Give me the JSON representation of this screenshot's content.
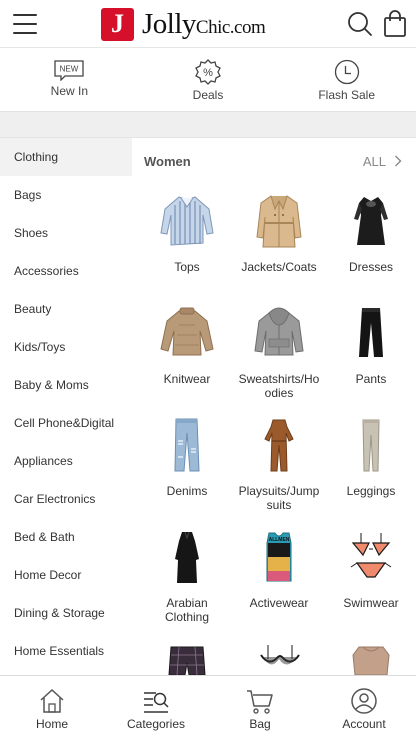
{
  "header": {
    "logo_mark": "J",
    "logo_big": "Jolly",
    "logo_rest": "Chic",
    "logo_suffix": ".com",
    "menu_icon": "hamburger-icon",
    "search_icon": "search-icon",
    "bag_icon": "shopping-bag-icon"
  },
  "quick_links": [
    {
      "label": "New In",
      "icon": "new-badge-icon",
      "badge": "NEW"
    },
    {
      "label": "Deals",
      "icon": "percent-badge-icon"
    },
    {
      "label": "Flash Sale",
      "icon": "clock-icon"
    }
  ],
  "sidebar": {
    "items": [
      {
        "label": "Clothing"
      },
      {
        "label": "Bags"
      },
      {
        "label": "Shoes"
      },
      {
        "label": "Accessories"
      },
      {
        "label": "Beauty"
      },
      {
        "label": "Kids/Toys"
      },
      {
        "label": "Baby & Moms"
      },
      {
        "label": "Cell Phone&Digital"
      },
      {
        "label": "Appliances"
      },
      {
        "label": "Car Electronics"
      },
      {
        "label": "Bed & Bath"
      },
      {
        "label": "Home Decor"
      },
      {
        "label": "Dining & Storage"
      },
      {
        "label": "Home Essentials"
      }
    ],
    "active_index": 0
  },
  "main": {
    "section_title": "Women",
    "all_label": "ALL",
    "categories": [
      {
        "label": "Tops",
        "icon": "striped-shirt-image"
      },
      {
        "label": "Jackets/Coats",
        "icon": "trench-coat-image"
      },
      {
        "label": "Dresses",
        "icon": "black-dress-image"
      },
      {
        "label": "Knitwear",
        "icon": "knit-sweater-image"
      },
      {
        "label": "Sweatshirts/Hoodies",
        "icon": "gray-hoodie-image"
      },
      {
        "label": "Pants",
        "icon": "black-pants-image"
      },
      {
        "label": "Denims",
        "icon": "ripped-jeans-image"
      },
      {
        "label": "Playsuits/Jumpsuits",
        "icon": "brown-jumpsuit-image"
      },
      {
        "label": "Leggings",
        "icon": "gray-leggings-image"
      },
      {
        "label": "Arabian Clothing",
        "icon": "black-abaya-image"
      },
      {
        "label": "Activewear",
        "icon": "printed-tank-image"
      },
      {
        "label": "Swimwear",
        "icon": "bikini-image"
      },
      {
        "label": "",
        "icon": "plaid-shorts-image"
      },
      {
        "label": "",
        "icon": "lace-lingerie-image"
      },
      {
        "label": "",
        "icon": "satin-set-image"
      }
    ]
  },
  "bottom_nav": [
    {
      "label": "Home",
      "icon": "home-icon"
    },
    {
      "label": "Categories",
      "icon": "categories-icon"
    },
    {
      "label": "Bag",
      "icon": "cart-icon"
    },
    {
      "label": "Account",
      "icon": "account-icon"
    }
  ],
  "colors": {
    "brand_red": "#d6102a",
    "active_sidebar_bg": "#f2f2f2",
    "divider_gray": "#efefef"
  }
}
